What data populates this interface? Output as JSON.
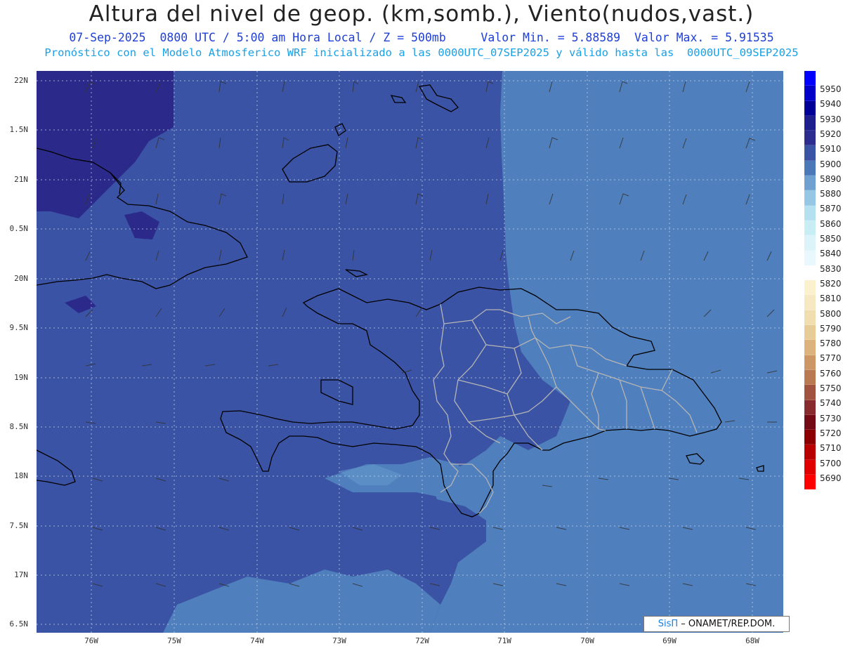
{
  "header": {
    "title": "Altura del nivel de geop. (km,somb.), Viento(nudos,vast.)",
    "subtitle1": "07-Sep-2025  0800 UTC / 5:00 am Hora Local / Z = 500mb     Valor Min. = 5.88589  Valor Max. = 5.91535",
    "subtitle2": "Pronóstico con el Modelo Atmosferico WRF inicializado a las 0000UTC_07SEP2025 y válido hasta las  0000UTC_09SEP2025"
  },
  "axes": {
    "lat_labels": [
      "22N",
      "1.5N",
      "21N",
      "0.5N",
      "20N",
      "9.5N",
      "19N",
      "8.5N",
      "18N",
      "7.5N",
      "17N",
      "6.5N"
    ],
    "lon_labels": [
      "76W",
      "75W",
      "74W",
      "73W",
      "72W",
      "71W",
      "70W",
      "69W",
      "68W"
    ]
  },
  "colorbar": {
    "levels": [
      "5950",
      "5940",
      "5930",
      "5920",
      "5910",
      "5900",
      "5890",
      "5880",
      "5870",
      "5860",
      "5850",
      "5840",
      "5830",
      "5820",
      "5810",
      "5800",
      "5790",
      "5780",
      "5770",
      "5760",
      "5750",
      "5740",
      "5730",
      "5720",
      "5710",
      "5700",
      "5690"
    ],
    "colors": [
      "#0000ff",
      "#0000c8",
      "#000096",
      "#1e1e8c",
      "#2d2d8f",
      "#3a53a4",
      "#4a78b8",
      "#6ea0d0",
      "#96c8e6",
      "#b4e1f0",
      "#c8edf5",
      "#dcf3fa",
      "#e8f8fc",
      "#ffffff",
      "#fbf1cf",
      "#f6e8c2",
      "#f1deb0",
      "#e8cc98",
      "#dcb37c",
      "#cc9665",
      "#b97a52",
      "#a2533f",
      "#892b2e",
      "#740a16",
      "#8a0000",
      "#b80000",
      "#e00000",
      "#ff0000"
    ]
  },
  "credit": {
    "brand": "SisΠ",
    "text": " – ONAMET/REP.DOM."
  },
  "map_colors": {
    "dark": "#2b2a8a",
    "mid": "#3a53a4",
    "light": "#4f7fbc",
    "lighter": "#6a9ed0",
    "coast": "#000000",
    "province": "#b5b5b5"
  }
}
